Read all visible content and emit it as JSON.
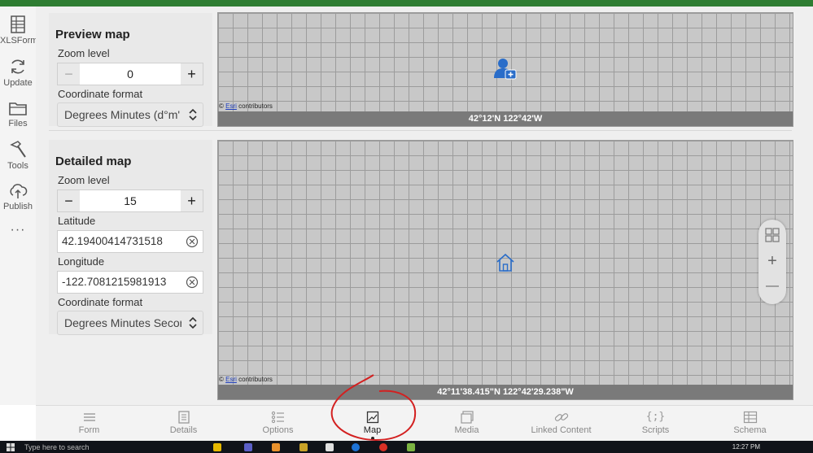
{
  "sidebar": {
    "items": [
      {
        "label": "XLSForm",
        "icon": "xlsform-icon"
      },
      {
        "label": "Update",
        "icon": "refresh-icon"
      },
      {
        "label": "Files",
        "icon": "folder-icon"
      },
      {
        "label": "Tools",
        "icon": "hammer-icon"
      },
      {
        "label": "Publish",
        "icon": "cloud-upload-icon"
      }
    ],
    "more": "···"
  },
  "preview_map": {
    "title": "Preview map",
    "zoom_label": "Zoom level",
    "zoom_value": "0",
    "coord_label": "Coordinate format",
    "coord_value": "Degrees Minutes (d°m'",
    "attribution_esri": "Esri",
    "attribution_rest": " contributors",
    "coord_readout": "42°12'N 122°42'W"
  },
  "detailed_map": {
    "title": "Detailed map",
    "zoom_label": "Zoom level",
    "zoom_value": "15",
    "lat_label": "Latitude",
    "lat_value": "42.19400414731518",
    "lon_label": "Longitude",
    "lon_value": "-122.7081215981913",
    "coord_label": "Coordinate format",
    "coord_value": "Degrees Minutes Secor",
    "attribution_esri": "Esri",
    "attribution_rest": " contributors",
    "coord_readout": "42°11'38.415\"N 122°42'29.238\"W"
  },
  "stepper": {
    "minus": "−",
    "plus": "+"
  },
  "map_controls": {
    "plus": "+",
    "minus": "—"
  },
  "bottom_tabs": [
    {
      "label": "Form",
      "icon": "form-icon"
    },
    {
      "label": "Details",
      "icon": "details-icon"
    },
    {
      "label": "Options",
      "icon": "options-icon"
    },
    {
      "label": "Map",
      "icon": "map-icon",
      "active": true
    },
    {
      "label": "Media",
      "icon": "media-icon"
    },
    {
      "label": "Linked Content",
      "icon": "link-icon"
    },
    {
      "label": "Scripts",
      "icon": "scripts-icon"
    },
    {
      "label": "Schema",
      "icon": "schema-icon"
    }
  ],
  "scripts_glyph": "{;}",
  "taskbar": {
    "search": "Type here to search",
    "time": "12:27 PM"
  },
  "colors": {
    "accent": "#2e7d32",
    "map_pin": "#2a6dc9",
    "annotation": "#d32020"
  }
}
